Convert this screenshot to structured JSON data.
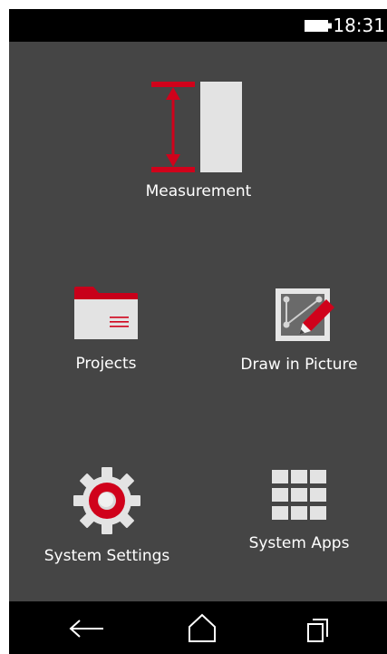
{
  "status_bar": {
    "time": "18:31",
    "battery_icon": "battery-full-icon"
  },
  "home": {
    "tiles": [
      {
        "label": "Measurement",
        "icon": "measurement-icon"
      },
      {
        "label": "Projects",
        "icon": "folder-icon"
      },
      {
        "label": "Draw in Picture",
        "icon": "draw-picture-icon"
      },
      {
        "label": "System Settings",
        "icon": "gear-icon"
      },
      {
        "label": "System Apps",
        "icon": "app-grid-icon"
      }
    ]
  },
  "nav_bar": {
    "back_icon": "back-arrow-icon",
    "home_icon": "home-icon",
    "recent_icon": "recent-apps-icon"
  },
  "colors": {
    "background": "#454545",
    "bars": "#000000",
    "accent_red": "#d0021b",
    "icon_light": "#e3e3e3",
    "text": "#ffffff"
  }
}
